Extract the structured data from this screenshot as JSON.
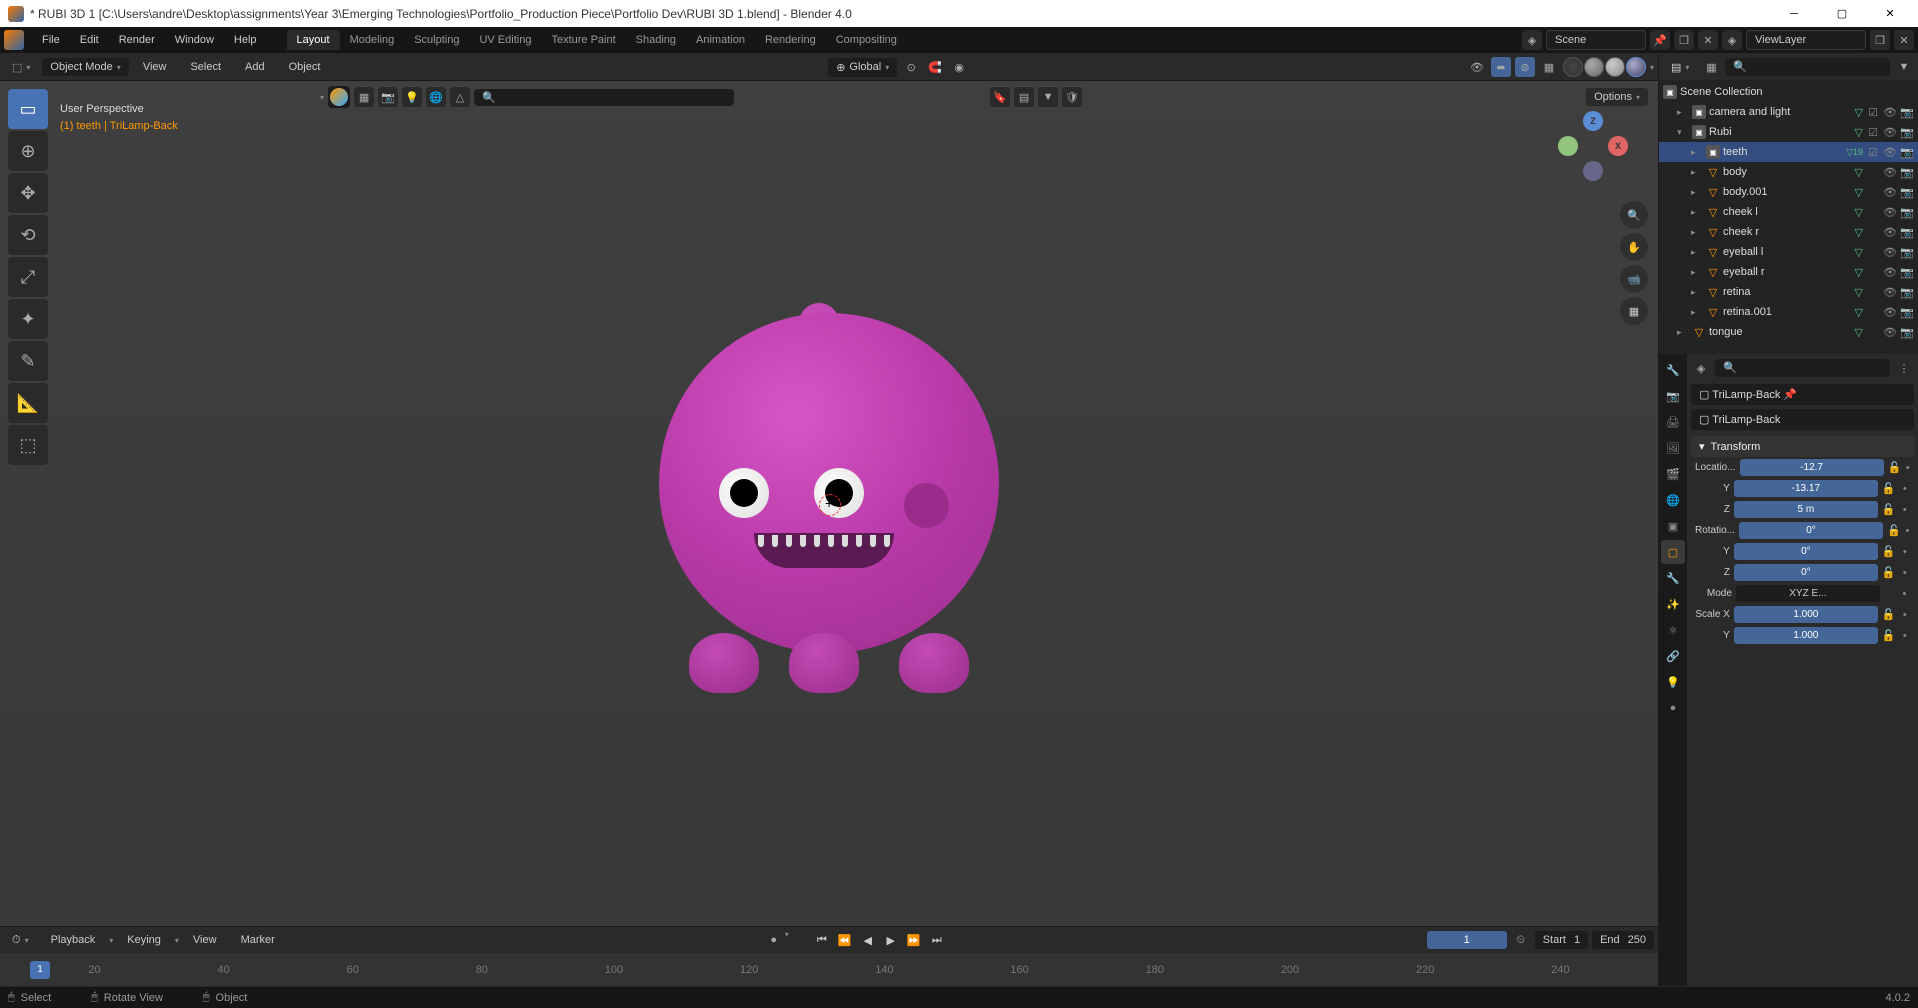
{
  "titlebar": {
    "title": "* RUBI 3D 1 [C:\\Users\\andre\\Desktop\\assignments\\Year 3\\Emerging Technologies\\Portfolio_Production Piece\\Portfolio Dev\\RUBI 3D 1.blend] - Blender 4.0"
  },
  "menubar": {
    "items": [
      "File",
      "Edit",
      "Render",
      "Window",
      "Help"
    ],
    "workspaces": [
      "Layout",
      "Modeling",
      "Sculpting",
      "UV Editing",
      "Texture Paint",
      "Shading",
      "Animation",
      "Rendering",
      "Compositing"
    ],
    "active_workspace": "Layout",
    "scene": "Scene",
    "viewlayer": "ViewLayer"
  },
  "viewport_header": {
    "mode": "Object Mode",
    "menus": [
      "View",
      "Select",
      "Add",
      "Object"
    ],
    "orientation": "Global",
    "options": "Options"
  },
  "overlay": {
    "line1": "User Perspective",
    "line2": "(1) teeth | TriLamp-Back"
  },
  "gizmo": {
    "z": "Z",
    "x": "X"
  },
  "timeline": {
    "menus": [
      "Playback",
      "Keying",
      "View",
      "Marker"
    ],
    "current_frame": "1",
    "start_label": "Start",
    "start_value": "1",
    "end_label": "End",
    "end_value": "250",
    "ticks": [
      "20",
      "40",
      "60",
      "80",
      "100",
      "120",
      "140",
      "160",
      "180",
      "200",
      "220",
      "240"
    ]
  },
  "statusbar": {
    "select": "Select",
    "rotate": "Rotate View",
    "object": "Object",
    "version": "4.0.2"
  },
  "outliner": {
    "root": "Scene Collection",
    "items": [
      {
        "label": "camera and light",
        "type": "collection",
        "indent": 1,
        "expand": "▸"
      },
      {
        "label": "Rubi",
        "type": "collection",
        "indent": 1,
        "expand": "▾"
      },
      {
        "label": "teeth",
        "type": "collection",
        "indent": 2,
        "expand": "▸",
        "selected": true,
        "badge": "19"
      },
      {
        "label": "body",
        "type": "mesh",
        "indent": 2,
        "expand": "▸"
      },
      {
        "label": "body.001",
        "type": "mesh",
        "indent": 2,
        "expand": "▸"
      },
      {
        "label": "cheek l",
        "type": "mesh",
        "indent": 2,
        "expand": "▸"
      },
      {
        "label": "cheek r",
        "type": "mesh",
        "indent": 2,
        "expand": "▸"
      },
      {
        "label": "eyeball l",
        "type": "mesh",
        "indent": 2,
        "expand": "▸"
      },
      {
        "label": "eyeball r",
        "type": "mesh",
        "indent": 2,
        "expand": "▸"
      },
      {
        "label": "retina",
        "type": "mesh",
        "indent": 2,
        "expand": "▸"
      },
      {
        "label": "retina.001",
        "type": "mesh",
        "indent": 2,
        "expand": "▸"
      },
      {
        "label": "tongue",
        "type": "mesh",
        "indent": 1,
        "expand": "▸"
      }
    ]
  },
  "properties": {
    "breadcrumb": "TriLamp-Back",
    "object_name": "TriLamp-Back",
    "transform_header": "Transform",
    "location_label": "Locatio...",
    "location": {
      "x": "-12.7",
      "y": "-13.17",
      "z": "5 m"
    },
    "rotation_label": "Rotatio...",
    "rotation": {
      "x": "0°",
      "y": "0°",
      "z": "0°"
    },
    "mode_label": "Mode",
    "mode_value": "XYZ E...",
    "scale_label": "Scale X",
    "scale": {
      "x": "1.000",
      "y": "1.000"
    },
    "axis_y": "Y",
    "axis_z": "Z"
  }
}
